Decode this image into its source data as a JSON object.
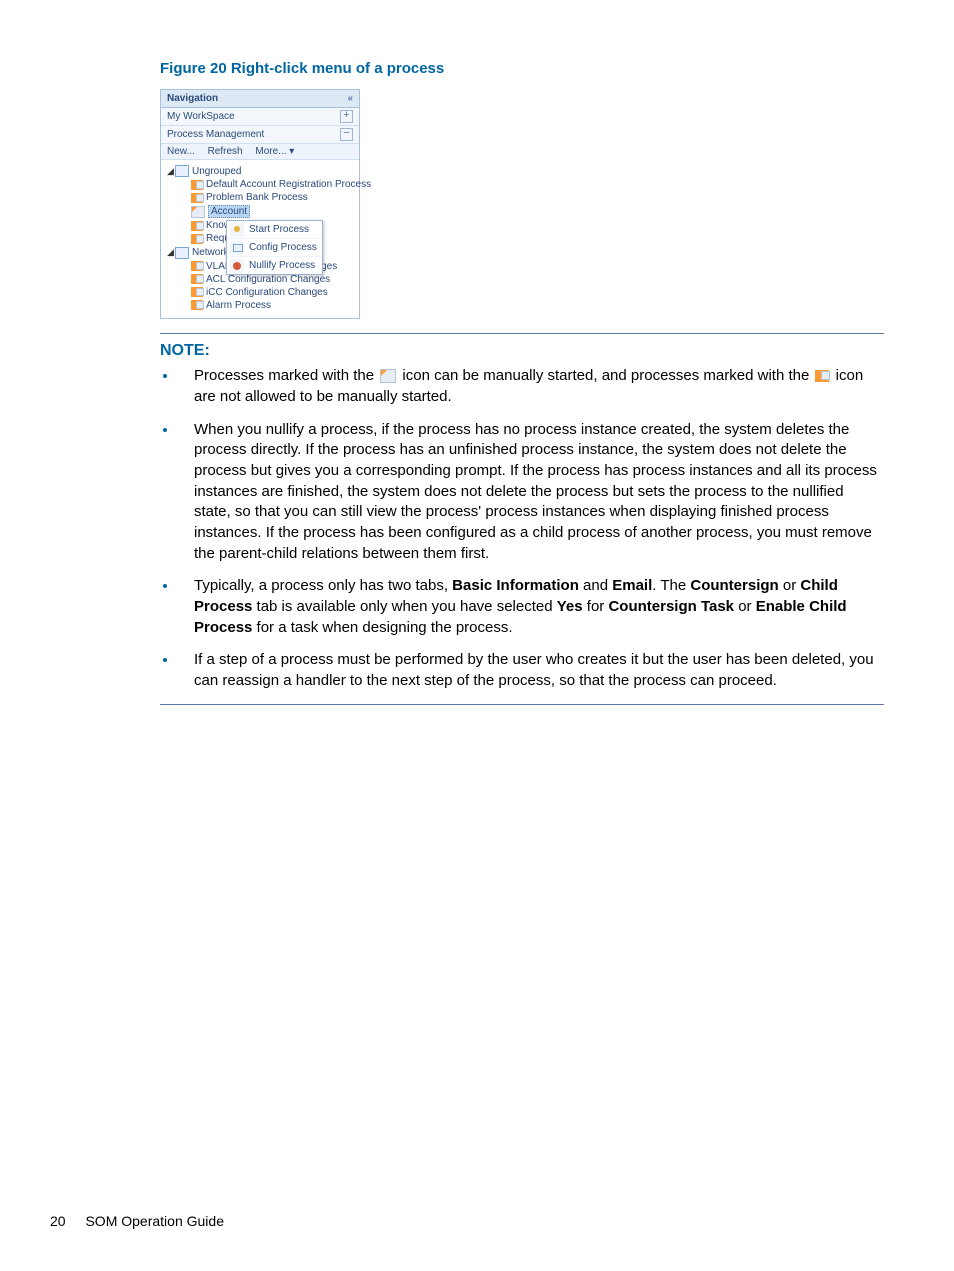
{
  "figure": {
    "caption": "Figure 20 Right-click menu of a process"
  },
  "nav": {
    "title": "Navigation",
    "rows": {
      "workspace": "My WorkSpace",
      "pm": "Process Management"
    },
    "toolbar": {
      "new": "New...",
      "refresh": "Refresh",
      "more": "More... ▾"
    },
    "groups": {
      "g1": {
        "label": "Ungrouped",
        "items": {
          "p1": "Default Account Registration Process",
          "p2": "Problem Bank Process",
          "p3": "Account",
          "p4": "Know",
          "p5": "Reque"
        }
      },
      "g2": {
        "label": "Network",
        "items": {
          "p6": "VLAN Configuration Changes",
          "p7": "ACL Configuration Changes",
          "p8": "iCC Configuration Changes",
          "p9": "Alarm Process"
        }
      }
    }
  },
  "ctx": {
    "start": "Start Process",
    "config": "Config Process",
    "nullify": "Nullify Process"
  },
  "note": {
    "heading": "NOTE:",
    "b1a": "Processes marked with the ",
    "b1b": " icon can be manually started, and processes marked with the ",
    "b1c": " icon are not allowed to be manually started.",
    "b2": "When you nullify a process, if the process has no process instance created, the system deletes the process directly. If the process has an unfinished process instance, the system does not delete the process but gives you a corresponding prompt. If the process has process instances and all its process instances are finished, the system does not delete the process but sets the process to the nullified state, so that you can still view the process' process instances when displaying finished process instances. If the process has been configured as a child process of another process, you must remove the parent-child relations between them first.",
    "b3a": "Typically, a process only has two tabs, ",
    "b3_bi": "Basic Information",
    "b3b": " and ",
    "b3_em": "Email",
    "b3c": ". The ",
    "b3_cs": "Countersign",
    "b3d": " or ",
    "b3_cp": "Child Process",
    "b3e": " tab is available only when you have selected ",
    "b3_yes": "Yes",
    "b3f": " for ",
    "b3_ct": "Countersign Task",
    "b3g": " or ",
    "b3_ecp": "Enable Child Process",
    "b3h": " for a task when designing the process.",
    "b4": "If a step of a process must be performed by the user who creates it but the user has been deleted, you can reassign a handler to the next step of the process, so that the process can proceed."
  },
  "footer": {
    "page": "20",
    "title": "SOM Operation Guide"
  }
}
